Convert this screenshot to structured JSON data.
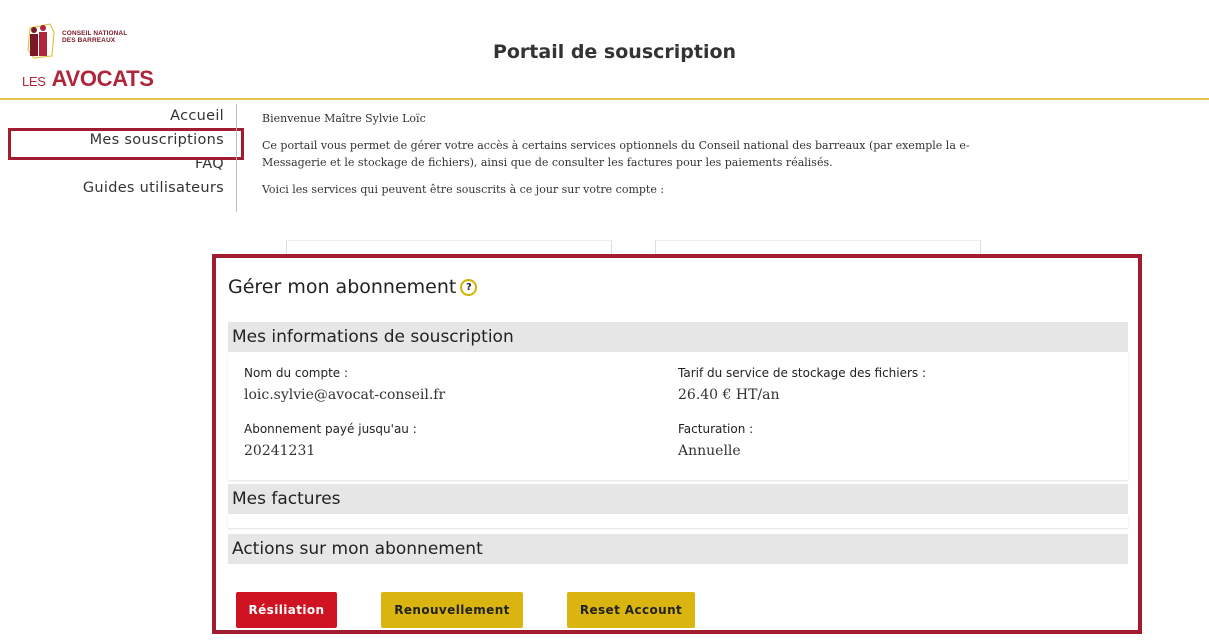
{
  "header": {
    "logo_subtitle_line1": "CONSEIL NATIONAL",
    "logo_subtitle_line2": "DES BARREAUX",
    "logo_prefix": "LES",
    "logo_word": "AVOCATS",
    "title": "Portail de souscription"
  },
  "nav": {
    "items": [
      {
        "label": "Accueil"
      },
      {
        "label": "Mes souscriptions"
      },
      {
        "label": "FAQ"
      },
      {
        "label": "Guides utilisateurs"
      }
    ],
    "active": "Mes souscriptions"
  },
  "intro": {
    "welcome": "Bienvenue Maître Sylvie Loïc",
    "description": "Ce portail vous permet de gérer votre accès à certains services optionnels du Conseil national des barreaux (par exemple la e-Messagerie et le stockage de fichiers), ainsi que de consulter les factures pour les paiements réalisés.",
    "description_line1": "Ce portail vous permet de gérer votre accès à certains services optionnels du Conseil national des barreaux (par exemple la e-",
    "description_line2": "Messagerie et le stockage de fichiers), ainsi que de consulter les factures pour les paiements réalisés.",
    "services_intro": "Voici les services qui peuvent être souscrits à ce jour sur votre compte :"
  },
  "panel": {
    "title": "Gérer mon abonnement",
    "help_icon": "?",
    "subscription_section": {
      "heading": "Mes informations de souscription",
      "account_label": "Nom du compte :",
      "account_value": "loic.sylvie@avocat-conseil.fr",
      "paid_until_label": "Abonnement payé jusqu'au :",
      "paid_until_value": "20241231",
      "tariff_label": "Tarif du service de stockage des fichiers :",
      "tariff_value": "26.40 € HT/an",
      "billing_label": "Facturation :",
      "billing_value": "Annuelle"
    },
    "invoices_section": {
      "heading": "Mes factures"
    },
    "actions_section": {
      "heading": "Actions sur mon abonnement",
      "buttons": [
        {
          "label": "Résiliation",
          "color": "#cf1322"
        },
        {
          "label": "Renouvellement",
          "color": "#dbb50f"
        },
        {
          "label": "Reset Account",
          "color": "#dbb50f"
        }
      ]
    }
  },
  "colors": {
    "highlight_border": "#a01c2e",
    "header_rule": "#e2c54a",
    "brand": "#b1253a"
  }
}
